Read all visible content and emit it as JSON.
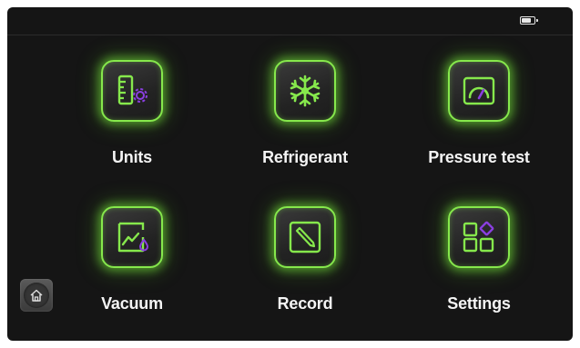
{
  "status_bar": {
    "battery_level": 0.8,
    "battery_icon": "battery-icon"
  },
  "menu": {
    "items": [
      {
        "label": "Units",
        "icon": "units-icon"
      },
      {
        "label": "Refrigerant",
        "icon": "snowflake-icon"
      },
      {
        "label": "Pressure test",
        "icon": "gauge-icon"
      },
      {
        "label": "Vacuum",
        "icon": "vacuum-chart-icon"
      },
      {
        "label": "Record",
        "icon": "record-edit-icon"
      },
      {
        "label": "Settings",
        "icon": "settings-grid-icon"
      }
    ]
  },
  "home": {
    "icon": "home-icon"
  },
  "colors": {
    "accent": "#86e84c",
    "secondary": "#8a3fe0",
    "background": "#151515"
  }
}
